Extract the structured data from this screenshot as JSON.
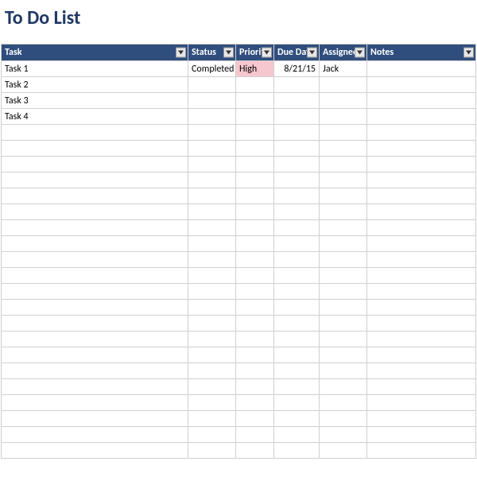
{
  "title": "To Do List",
  "headers": {
    "task": "Task",
    "status": "Status",
    "priority": "Priority",
    "due_date": "Due Date",
    "assignee": "Assignee",
    "notes": "Notes"
  },
  "rows": [
    {
      "task": "Task 1",
      "status": "Completed",
      "priority": "High",
      "due_date": "8/21/15",
      "assignee": "Jack",
      "notes": ""
    },
    {
      "task": "Task 2",
      "status": "",
      "priority": "",
      "due_date": "",
      "assignee": "",
      "notes": ""
    },
    {
      "task": "Task 3",
      "status": "",
      "priority": "",
      "due_date": "",
      "assignee": "",
      "notes": ""
    },
    {
      "task": "Task 4",
      "status": "",
      "priority": "",
      "due_date": "",
      "assignee": "",
      "notes": ""
    },
    {
      "task": "",
      "status": "",
      "priority": "",
      "due_date": "",
      "assignee": "",
      "notes": ""
    },
    {
      "task": "",
      "status": "",
      "priority": "",
      "due_date": "",
      "assignee": "",
      "notes": ""
    },
    {
      "task": "",
      "status": "",
      "priority": "",
      "due_date": "",
      "assignee": "",
      "notes": ""
    },
    {
      "task": "",
      "status": "",
      "priority": "",
      "due_date": "",
      "assignee": "",
      "notes": ""
    },
    {
      "task": "",
      "status": "",
      "priority": "",
      "due_date": "",
      "assignee": "",
      "notes": ""
    },
    {
      "task": "",
      "status": "",
      "priority": "",
      "due_date": "",
      "assignee": "",
      "notes": ""
    },
    {
      "task": "",
      "status": "",
      "priority": "",
      "due_date": "",
      "assignee": "",
      "notes": ""
    },
    {
      "task": "",
      "status": "",
      "priority": "",
      "due_date": "",
      "assignee": "",
      "notes": ""
    },
    {
      "task": "",
      "status": "",
      "priority": "",
      "due_date": "",
      "assignee": "",
      "notes": ""
    },
    {
      "task": "",
      "status": "",
      "priority": "",
      "due_date": "",
      "assignee": "",
      "notes": ""
    },
    {
      "task": "",
      "status": "",
      "priority": "",
      "due_date": "",
      "assignee": "",
      "notes": ""
    },
    {
      "task": "",
      "status": "",
      "priority": "",
      "due_date": "",
      "assignee": "",
      "notes": ""
    },
    {
      "task": "",
      "status": "",
      "priority": "",
      "due_date": "",
      "assignee": "",
      "notes": ""
    },
    {
      "task": "",
      "status": "",
      "priority": "",
      "due_date": "",
      "assignee": "",
      "notes": ""
    },
    {
      "task": "",
      "status": "",
      "priority": "",
      "due_date": "",
      "assignee": "",
      "notes": ""
    },
    {
      "task": "",
      "status": "",
      "priority": "",
      "due_date": "",
      "assignee": "",
      "notes": ""
    },
    {
      "task": "",
      "status": "",
      "priority": "",
      "due_date": "",
      "assignee": "",
      "notes": ""
    },
    {
      "task": "",
      "status": "",
      "priority": "",
      "due_date": "",
      "assignee": "",
      "notes": ""
    },
    {
      "task": "",
      "status": "",
      "priority": "",
      "due_date": "",
      "assignee": "",
      "notes": ""
    },
    {
      "task": "",
      "status": "",
      "priority": "",
      "due_date": "",
      "assignee": "",
      "notes": ""
    },
    {
      "task": "",
      "status": "",
      "priority": "",
      "due_date": "",
      "assignee": "",
      "notes": ""
    }
  ],
  "colors": {
    "header_bg": "#2f4e7e",
    "priority_high_bg": "#f7c7ce"
  }
}
